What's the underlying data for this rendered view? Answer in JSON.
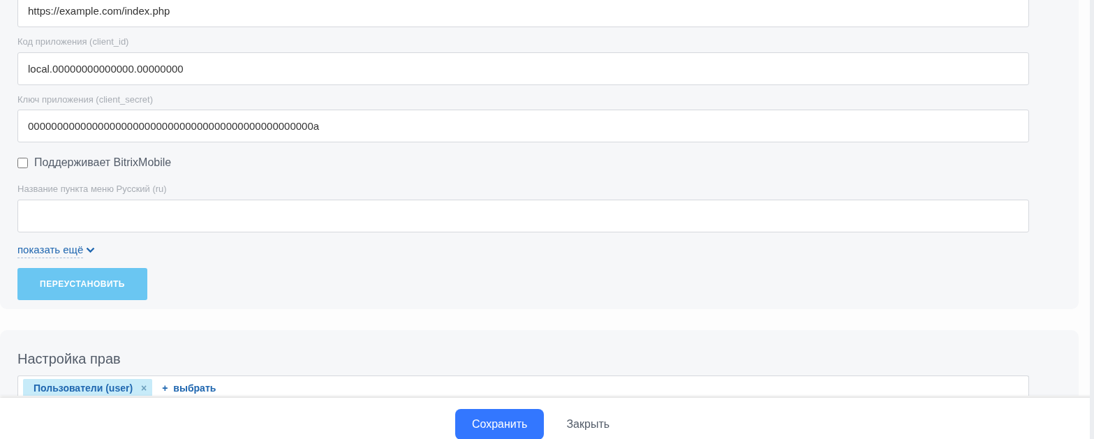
{
  "app_section": {
    "fields": [
      {
        "kind": "input",
        "value": "https://example.com/index.php"
      },
      {
        "kind": "input",
        "label": "Код приложения (client_id)",
        "value": "local.00000000000000.00000000"
      },
      {
        "kind": "input",
        "label": "Ключ приложения (client_secret)",
        "value": "0000000000000000000000000000000000000000000000000a"
      },
      {
        "kind": "checkbox",
        "label": "Поддерживает BitrixMobile",
        "checked": false
      },
      {
        "kind": "input",
        "label": "Название пункта меню Русский (ru)"
      }
    ],
    "show_more": "показать ещё",
    "reinstall_button": {
      "label": "ПЕРЕУСТАНОВИТЬ",
      "disabled": true
    }
  },
  "rights_section": {
    "title": "Настройка прав",
    "tags": [
      {
        "label": "Пользователи (user)",
        "remove": "×"
      }
    ],
    "add_link": "+ выбрать"
  },
  "footer": {
    "buttons": [
      {
        "label": "Сохранить",
        "kind": "primary"
      },
      {
        "label": "Закрыть",
        "kind": "link"
      }
    ]
  }
}
